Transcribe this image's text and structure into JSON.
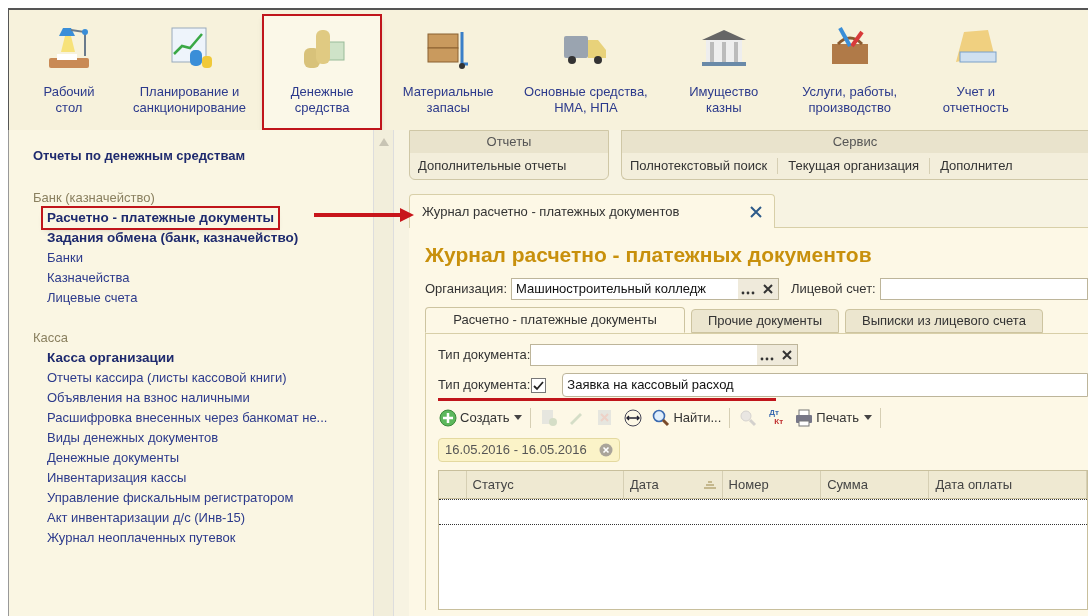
{
  "sections": [
    {
      "label": "Рабочий\nстол",
      "selected": false
    },
    {
      "label": "Планирование и\nсанкционирование",
      "selected": false
    },
    {
      "label": "Денежные\nсредства",
      "selected": true
    },
    {
      "label": "Материальные\nзапасы",
      "selected": false
    },
    {
      "label": "Основные средства,\nНМА, НПА",
      "selected": false
    },
    {
      "label": "Имущество\nказны",
      "selected": false
    },
    {
      "label": "Услуги, работы,\nпроизводство",
      "selected": false
    },
    {
      "label": "Учет и\nотчетность",
      "selected": false
    }
  ],
  "sidebar": {
    "top_link": "Отчеты по денежным средствам",
    "groups": [
      {
        "title": "Банк (казначейство)",
        "items": [
          {
            "label": "Расчетно - платежные документы",
            "bold": true,
            "selected": true
          },
          {
            "label": "Задания обмена (банк, казначейство)",
            "bold": true,
            "selected": false
          },
          {
            "label": "Банки",
            "bold": false,
            "selected": false
          },
          {
            "label": "Казначейства",
            "bold": false,
            "selected": false
          },
          {
            "label": "Лицевые счета",
            "bold": false,
            "selected": false
          }
        ]
      },
      {
        "title": "Касса",
        "items": [
          {
            "label": "Касса организации",
            "bold": true,
            "selected": false
          },
          {
            "label": "Отчеты кассира (листы кассовой книги)",
            "bold": false,
            "selected": false
          },
          {
            "label": "Объявления на взнос наличными",
            "bold": false,
            "selected": false
          },
          {
            "label": "Расшифровка внесенных через банкомат не...",
            "bold": false,
            "selected": false
          },
          {
            "label": "Виды денежных документов",
            "bold": false,
            "selected": false
          },
          {
            "label": "Денежные документы",
            "bold": false,
            "selected": false
          },
          {
            "label": "Инвентаризация кассы",
            "bold": false,
            "selected": false
          },
          {
            "label": "Управление фискальным регистратором",
            "bold": false,
            "selected": false
          },
          {
            "label": "Акт инвентаризации д/с (Инв-15)",
            "bold": false,
            "selected": false
          },
          {
            "label": "Журнал неоплаченных путевок",
            "bold": false,
            "selected": false
          }
        ]
      }
    ]
  },
  "command_groups": [
    {
      "title": "Отчеты",
      "items": [
        "Дополнительные отчеты"
      ]
    },
    {
      "title": "Сервис",
      "items": [
        "Полнотекстовый поиск",
        "Текущая организация",
        "Дополнител"
      ]
    }
  ],
  "open_tab": {
    "label": "Журнал расчетно - платежных документов"
  },
  "form": {
    "title": "Журнал расчетно - платежных документов",
    "organization": {
      "label": "Организация:",
      "value": "Машиностроительный колледж"
    },
    "account": {
      "label": "Лицевой счет:"
    },
    "tabs": [
      {
        "label": "Расчетно - платежные документы",
        "selected": true
      },
      {
        "label": "Прочие документы",
        "selected": false
      },
      {
        "label": "Выписки из лицевого счета",
        "selected": false
      }
    ],
    "filters": [
      {
        "kind": "select",
        "label": "Тип документа:",
        "underlined": false
      },
      {
        "kind": "checkbox",
        "label": "Тип документа:",
        "checked": true,
        "value": "Заявка на кассовый расход",
        "underlined": true
      }
    ],
    "toolbar": [
      {
        "kind": "button",
        "label": "Создать",
        "disabled": false
      },
      {
        "kind": "icon",
        "disabled": true
      },
      {
        "kind": "icon",
        "disabled": true
      },
      {
        "kind": "icon",
        "disabled": true
      },
      {
        "kind": "icon",
        "disabled": false
      },
      {
        "kind": "button",
        "label": "Найти...",
        "disabled": false
      },
      {
        "kind": "icon",
        "disabled": true
      },
      {
        "kind": "debit_credit",
        "top": "Дт",
        "bottom": "Кт",
        "disabled": false
      },
      {
        "kind": "button",
        "label": "Печать",
        "disabled": false
      }
    ],
    "period": "16.05.2016 - 16.05.2016",
    "columns": [
      {
        "label": "Статус",
        "sorted": false
      },
      {
        "label": "Дата",
        "sorted": true
      },
      {
        "label": "Номер",
        "sorted": false
      },
      {
        "label": "Сумма",
        "sorted": false
      },
      {
        "label": "Дата оплаты",
        "sorted": false
      }
    ]
  }
}
